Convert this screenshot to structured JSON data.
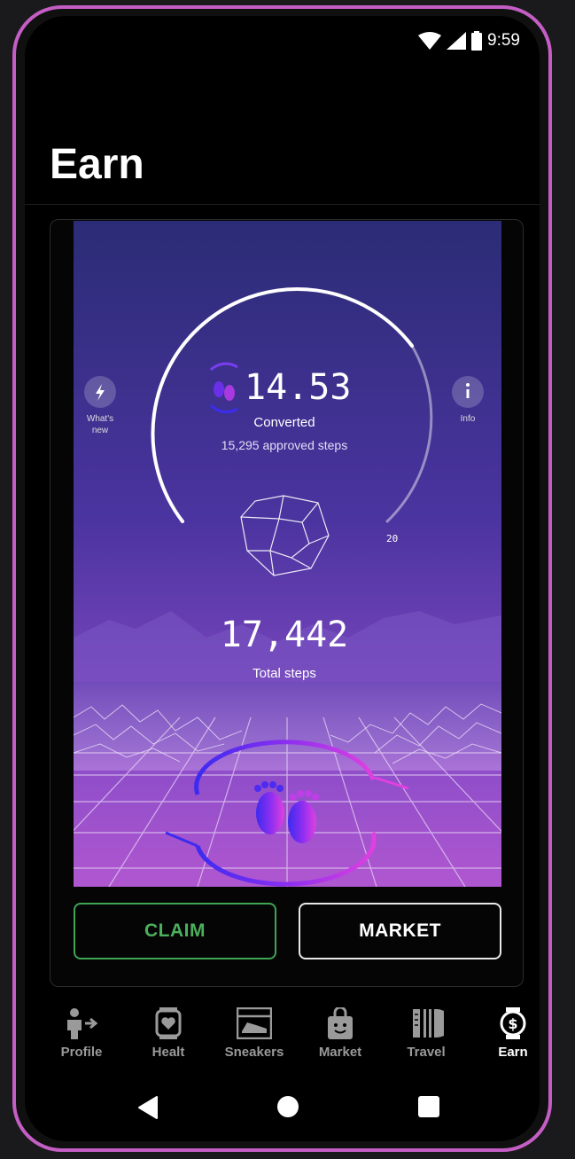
{
  "status_bar": {
    "time": "9:59"
  },
  "header": {
    "title": "Earn"
  },
  "dashboard": {
    "converted_value": "14.53",
    "converted_label": "Converted",
    "approved_steps": "15,295 approved steps",
    "gauge_max": "20",
    "gauge_fraction": 0.72,
    "total_steps": "17,442",
    "total_steps_label": "Total steps",
    "whats_new_line1": "What's",
    "whats_new_line2": "new",
    "info_label": "Info"
  },
  "actions": {
    "claim": "CLAIM",
    "market": "MARKET"
  },
  "nav": {
    "items": [
      {
        "label": "Profile",
        "icon": "profile-icon"
      },
      {
        "label": "Healt",
        "icon": "watch-heart-icon"
      },
      {
        "label": "Sneakers",
        "icon": "sneakers-icon"
      },
      {
        "label": "Market",
        "icon": "shopping-bag-icon"
      },
      {
        "label": "Travel",
        "icon": "travel-icon"
      },
      {
        "label": "Earn",
        "icon": "earn-watch-icon"
      }
    ],
    "active": "Earn"
  },
  "colors": {
    "accent_green": "#4caf5c",
    "frame": "#c45ec4",
    "gradient_top": "#2d2e7a",
    "gradient_bottom": "#a64fd0"
  }
}
